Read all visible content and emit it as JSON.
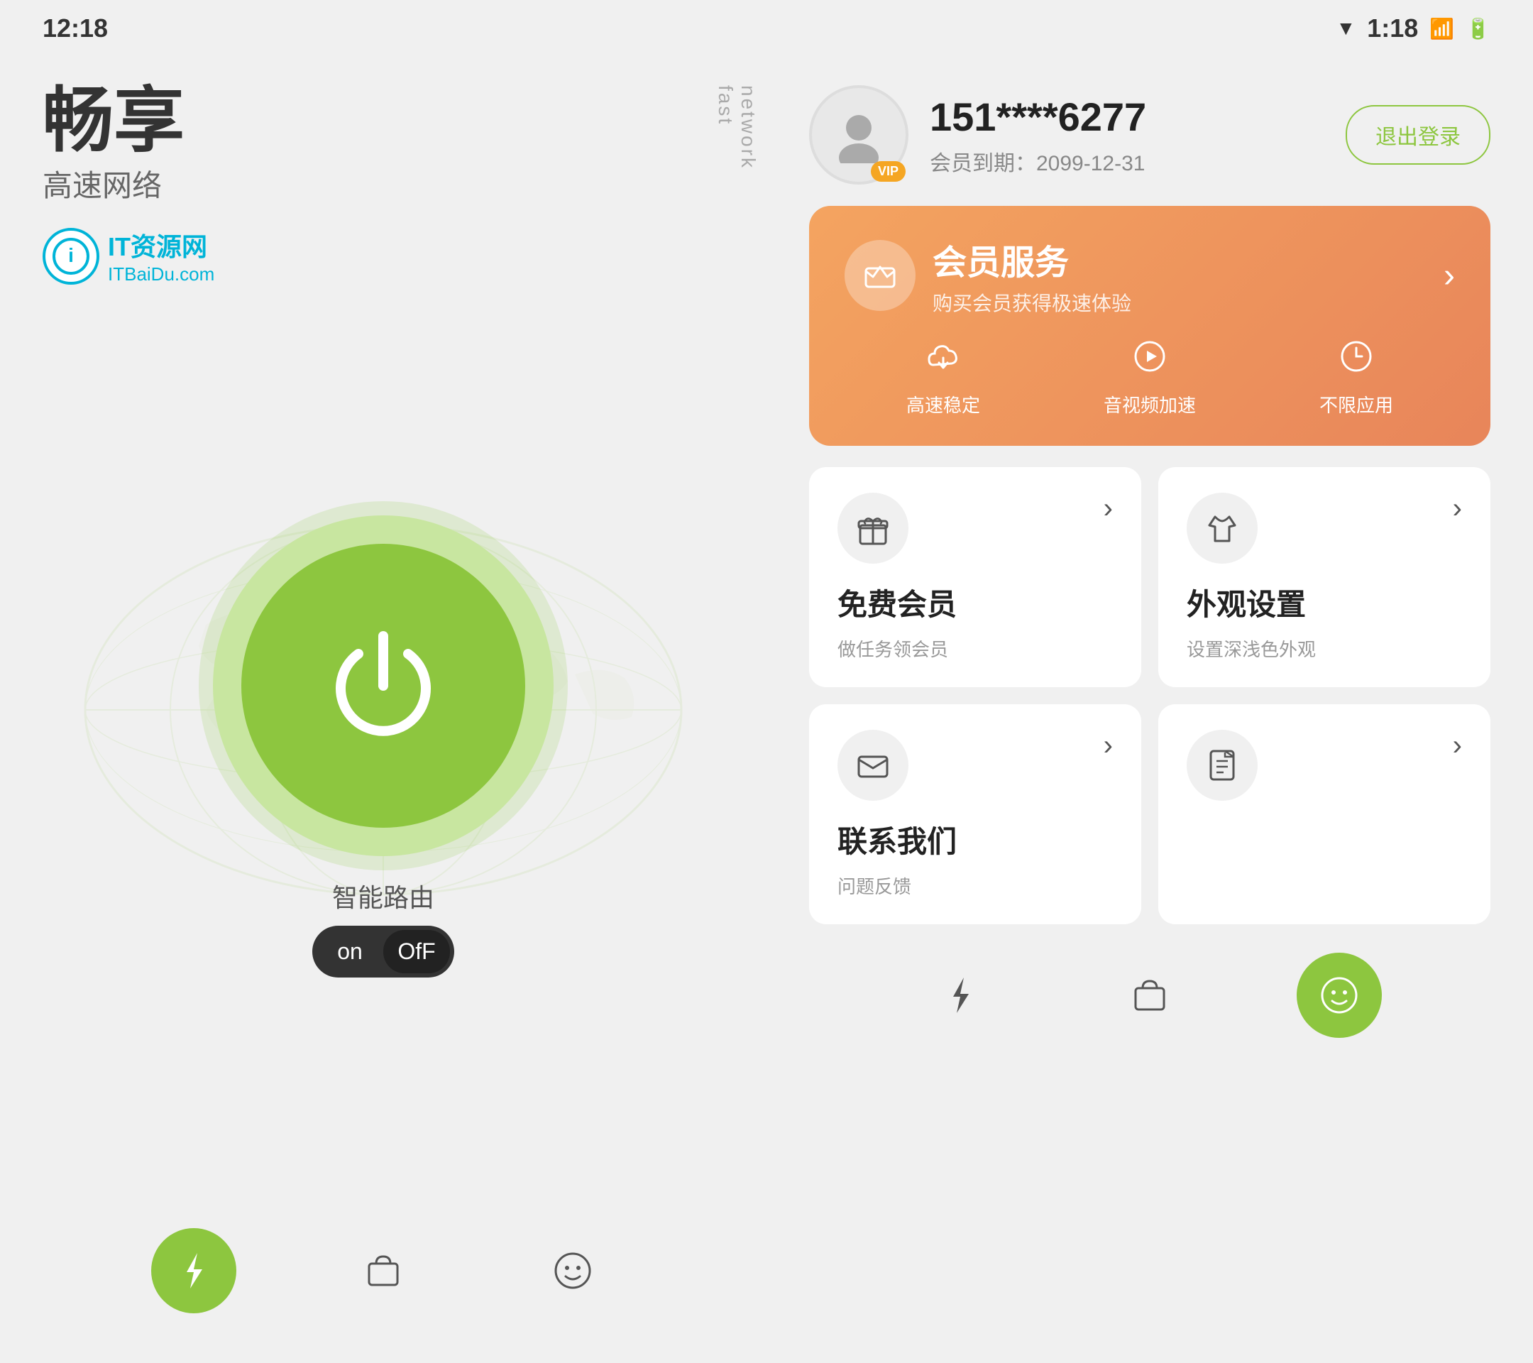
{
  "statusBar": {
    "leftTime": "12:18",
    "rightTime": "1:18",
    "leftIcons": [
      "battery",
      "signal"
    ],
    "rightIcons": [
      "wifi",
      "battery-right",
      "signal-right"
    ]
  },
  "leftPanel": {
    "titleMain": "畅享",
    "titleSub": "高速网络",
    "titleFast": "fast network",
    "watermark": {
      "prefix": "i",
      "brand": "IT资源网",
      "site": "ITBaiDu.com"
    },
    "powerLabel": "智能路由",
    "toggleOn": "on",
    "toggleOff": "OfF",
    "nav": [
      {
        "icon": "⚡",
        "active": true
      },
      {
        "icon": "🛍",
        "active": false
      },
      {
        "icon": "☺",
        "active": false
      }
    ]
  },
  "rightPanel": {
    "user": {
      "phone": "151****6277",
      "expiry": "会员到期：2099-12-31",
      "logoutBtn": "退出登录"
    },
    "vipCard": {
      "title": "会员服务",
      "subtitle": "购买会员获得极速体验",
      "features": [
        {
          "label": "高速稳定"
        },
        {
          "label": "音视频加速"
        },
        {
          "label": "不限应用"
        }
      ]
    },
    "cards": [
      {
        "title": "免费会员",
        "subtitle": "做任务领会员"
      },
      {
        "title": "外观设置",
        "subtitle": "设置深浅色外观"
      },
      {
        "title": "联系我们",
        "subtitle": "问题反馈"
      },
      {
        "title": "",
        "subtitle": ""
      }
    ],
    "bottomNav": [
      {
        "icon": "⚡",
        "active": false
      },
      {
        "icon": "🛍",
        "active": false
      },
      {
        "icon": "☺",
        "active": true
      }
    ]
  }
}
